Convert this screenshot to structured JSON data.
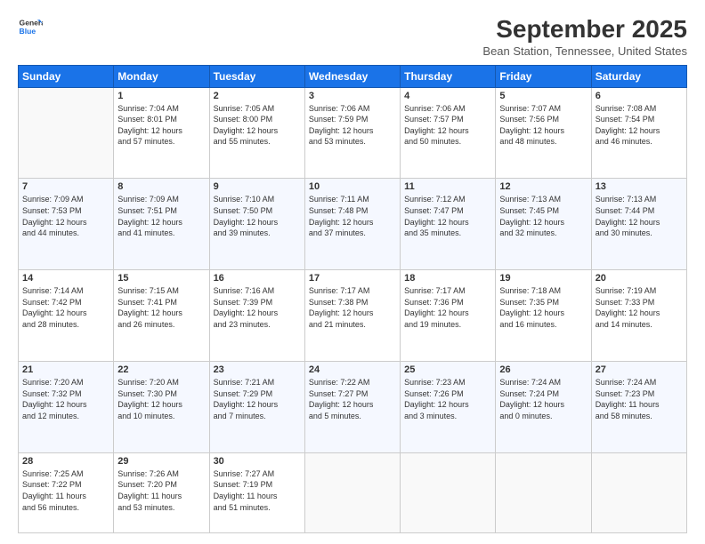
{
  "logo": {
    "line1": "General",
    "line2": "Blue"
  },
  "title": "September 2025",
  "subtitle": "Bean Station, Tennessee, United States",
  "headers": [
    "Sunday",
    "Monday",
    "Tuesday",
    "Wednesday",
    "Thursday",
    "Friday",
    "Saturday"
  ],
  "weeks": [
    [
      {
        "day": "",
        "info": ""
      },
      {
        "day": "1",
        "info": "Sunrise: 7:04 AM\nSunset: 8:01 PM\nDaylight: 12 hours\nand 57 minutes."
      },
      {
        "day": "2",
        "info": "Sunrise: 7:05 AM\nSunset: 8:00 PM\nDaylight: 12 hours\nand 55 minutes."
      },
      {
        "day": "3",
        "info": "Sunrise: 7:06 AM\nSunset: 7:59 PM\nDaylight: 12 hours\nand 53 minutes."
      },
      {
        "day": "4",
        "info": "Sunrise: 7:06 AM\nSunset: 7:57 PM\nDaylight: 12 hours\nand 50 minutes."
      },
      {
        "day": "5",
        "info": "Sunrise: 7:07 AM\nSunset: 7:56 PM\nDaylight: 12 hours\nand 48 minutes."
      },
      {
        "day": "6",
        "info": "Sunrise: 7:08 AM\nSunset: 7:54 PM\nDaylight: 12 hours\nand 46 minutes."
      }
    ],
    [
      {
        "day": "7",
        "info": "Sunrise: 7:09 AM\nSunset: 7:53 PM\nDaylight: 12 hours\nand 44 minutes."
      },
      {
        "day": "8",
        "info": "Sunrise: 7:09 AM\nSunset: 7:51 PM\nDaylight: 12 hours\nand 41 minutes."
      },
      {
        "day": "9",
        "info": "Sunrise: 7:10 AM\nSunset: 7:50 PM\nDaylight: 12 hours\nand 39 minutes."
      },
      {
        "day": "10",
        "info": "Sunrise: 7:11 AM\nSunset: 7:48 PM\nDaylight: 12 hours\nand 37 minutes."
      },
      {
        "day": "11",
        "info": "Sunrise: 7:12 AM\nSunset: 7:47 PM\nDaylight: 12 hours\nand 35 minutes."
      },
      {
        "day": "12",
        "info": "Sunrise: 7:13 AM\nSunset: 7:45 PM\nDaylight: 12 hours\nand 32 minutes."
      },
      {
        "day": "13",
        "info": "Sunrise: 7:13 AM\nSunset: 7:44 PM\nDaylight: 12 hours\nand 30 minutes."
      }
    ],
    [
      {
        "day": "14",
        "info": "Sunrise: 7:14 AM\nSunset: 7:42 PM\nDaylight: 12 hours\nand 28 minutes."
      },
      {
        "day": "15",
        "info": "Sunrise: 7:15 AM\nSunset: 7:41 PM\nDaylight: 12 hours\nand 26 minutes."
      },
      {
        "day": "16",
        "info": "Sunrise: 7:16 AM\nSunset: 7:39 PM\nDaylight: 12 hours\nand 23 minutes."
      },
      {
        "day": "17",
        "info": "Sunrise: 7:17 AM\nSunset: 7:38 PM\nDaylight: 12 hours\nand 21 minutes."
      },
      {
        "day": "18",
        "info": "Sunrise: 7:17 AM\nSunset: 7:36 PM\nDaylight: 12 hours\nand 19 minutes."
      },
      {
        "day": "19",
        "info": "Sunrise: 7:18 AM\nSunset: 7:35 PM\nDaylight: 12 hours\nand 16 minutes."
      },
      {
        "day": "20",
        "info": "Sunrise: 7:19 AM\nSunset: 7:33 PM\nDaylight: 12 hours\nand 14 minutes."
      }
    ],
    [
      {
        "day": "21",
        "info": "Sunrise: 7:20 AM\nSunset: 7:32 PM\nDaylight: 12 hours\nand 12 minutes."
      },
      {
        "day": "22",
        "info": "Sunrise: 7:20 AM\nSunset: 7:30 PM\nDaylight: 12 hours\nand 10 minutes."
      },
      {
        "day": "23",
        "info": "Sunrise: 7:21 AM\nSunset: 7:29 PM\nDaylight: 12 hours\nand 7 minutes."
      },
      {
        "day": "24",
        "info": "Sunrise: 7:22 AM\nSunset: 7:27 PM\nDaylight: 12 hours\nand 5 minutes."
      },
      {
        "day": "25",
        "info": "Sunrise: 7:23 AM\nSunset: 7:26 PM\nDaylight: 12 hours\nand 3 minutes."
      },
      {
        "day": "26",
        "info": "Sunrise: 7:24 AM\nSunset: 7:24 PM\nDaylight: 12 hours\nand 0 minutes."
      },
      {
        "day": "27",
        "info": "Sunrise: 7:24 AM\nSunset: 7:23 PM\nDaylight: 11 hours\nand 58 minutes."
      }
    ],
    [
      {
        "day": "28",
        "info": "Sunrise: 7:25 AM\nSunset: 7:22 PM\nDaylight: 11 hours\nand 56 minutes."
      },
      {
        "day": "29",
        "info": "Sunrise: 7:26 AM\nSunset: 7:20 PM\nDaylight: 11 hours\nand 53 minutes."
      },
      {
        "day": "30",
        "info": "Sunrise: 7:27 AM\nSunset: 7:19 PM\nDaylight: 11 hours\nand 51 minutes."
      },
      {
        "day": "",
        "info": ""
      },
      {
        "day": "",
        "info": ""
      },
      {
        "day": "",
        "info": ""
      },
      {
        "day": "",
        "info": ""
      }
    ]
  ]
}
